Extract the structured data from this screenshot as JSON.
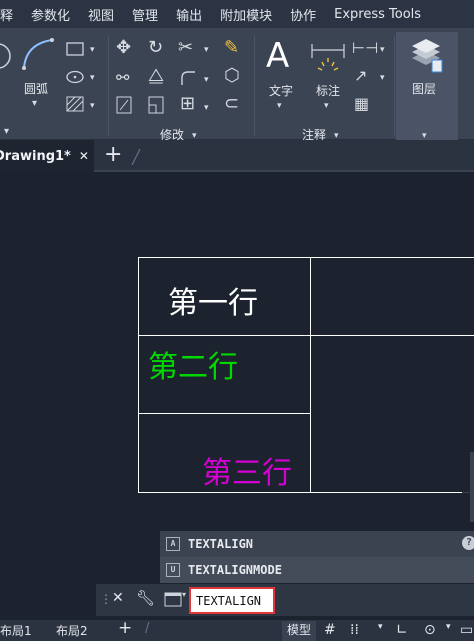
{
  "menubar": {
    "items": [
      "释",
      "参数化",
      "视图",
      "管理",
      "输出",
      "附加模块",
      "协作",
      "Express Tools"
    ]
  },
  "ribbon": {
    "arc_label": "圆弧",
    "modify_panel": "修改",
    "text_label": "文字",
    "dimension_label": "标注",
    "annotation_panel": "注释",
    "layers_label": "图层"
  },
  "tabs": {
    "document": "Drawing1*",
    "close": "✕",
    "new": "+"
  },
  "drawing": {
    "row1": "第一行",
    "row2": "第二行",
    "row3": "第三行",
    "colors": {
      "row1": "#ffffff",
      "row2": "#00d800",
      "row3": "#d400d4",
      "lines": "#ffffff"
    }
  },
  "commandline": {
    "history": [
      "TEXTALIGN",
      "TEXTALIGNMODE"
    ],
    "input": "TEXTALIGN"
  },
  "statusbar": {
    "layouts": [
      "布局1",
      "布局2"
    ],
    "add": "+",
    "model": "模型"
  }
}
